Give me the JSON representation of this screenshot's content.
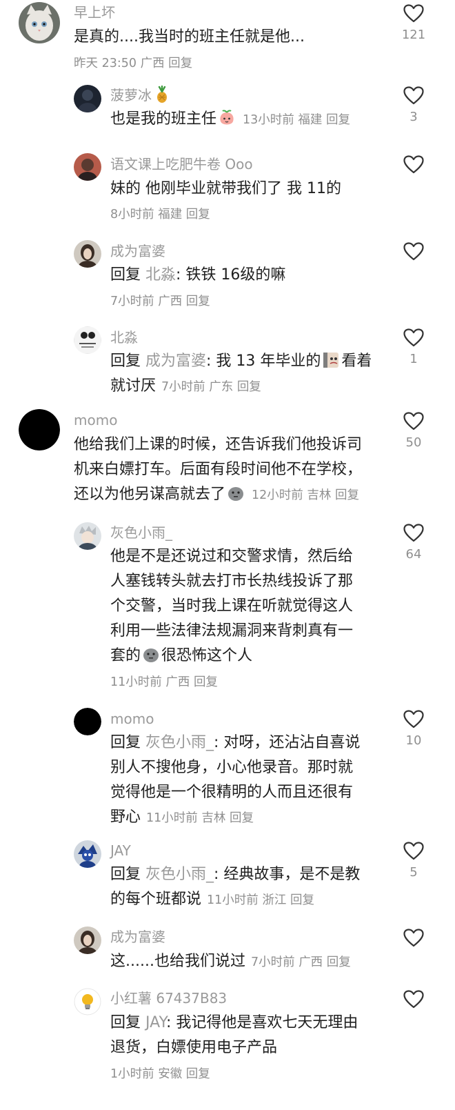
{
  "comments": [
    {
      "username": "早上坏",
      "lines": [
        "是真的....我当时的班主任就是他..."
      ],
      "time": "昨天 23:50",
      "location": "广西",
      "reply": "回复",
      "likes": "121"
    },
    {
      "username": "菠萝冰",
      "lines": [
        "也是我的班主任"
      ],
      "time": "13小时前",
      "location": "福建",
      "reply": "回复",
      "likes": "3"
    },
    {
      "username": "语文课上吃肥牛卷 Ooo",
      "lines": [
        "妹的 他刚毕业就带我们了 我 11的"
      ],
      "time": "8小时前",
      "location": "福建",
      "reply": "回复",
      "likes": ""
    },
    {
      "username": "成为富婆",
      "reply_prefix": "回复",
      "reply_to": "北淼",
      "lines": [
        ": 铁铁 16级的嘛"
      ],
      "time": "7小时前",
      "location": "广西",
      "reply": "回复",
      "likes": ""
    },
    {
      "username": "北淼",
      "reply_prefix": "回复",
      "reply_to": "成为富婆",
      "lines": [
        ": 我 13 年毕业的",
        "看着",
        "就讨厌"
      ],
      "time": "7小时前",
      "location": "广东",
      "reply": "回复",
      "likes": "1"
    },
    {
      "username": "momo",
      "lines": [
        "他给我们上课的时候，还告诉我们他投诉司",
        "机来白嫖打车。后面有段时间他不在学校，",
        "还以为他另谋高就去了"
      ],
      "time": "12小时前",
      "location": "吉林",
      "reply": "回复",
      "likes": "50"
    },
    {
      "username": "灰色小雨_",
      "lines": [
        "他是不是还说过和交警求情，然后给",
        "人塞钱转头就去打市长热线投诉了那",
        "个交警，当时我上课在听就觉得这人",
        "利用一些法律法规漏洞来背刺真有一",
        "套的",
        "很恐怖这个人"
      ],
      "time": "11小时前",
      "location": "广西",
      "reply": "回复",
      "likes": "64"
    },
    {
      "username": "momo",
      "reply_prefix": "回复",
      "reply_to": "灰色小雨_",
      "lines": [
        ": 对呀，还沾沾自喜说",
        "别人不搜他身，小心他录音。那时就",
        "觉得他是一个很精明的人而且还很有",
        "野心"
      ],
      "time": "11小时前",
      "location": "吉林",
      "reply": "回复",
      "likes": "10"
    },
    {
      "username": "JAY",
      "reply_prefix": "回复",
      "reply_to": "灰色小雨_",
      "lines": [
        ": 经典故事，是不是教",
        "的每个班都说"
      ],
      "time": "11小时前",
      "location": "浙江",
      "reply": "回复",
      "likes": "5"
    },
    {
      "username": "成为富婆",
      "lines": [
        "这......也给我们说过"
      ],
      "time": "7小时前",
      "location": "广西",
      "reply": "回复",
      "likes": ""
    },
    {
      "username": "小红薯 67437B83",
      "reply_prefix": "回复",
      "reply_to": "JAY",
      "lines": [
        ": 我记得他是喜欢七天无理由",
        "退货，白嫖使用电子产品"
      ],
      "time": "1小时前",
      "location": "安徽",
      "reply": "回复",
      "likes": ""
    }
  ],
  "icons": {
    "like": "heart-outline-icon",
    "pineapple": "pineapple-emoji",
    "peach": "peach-face-emoji",
    "meme": "meme-face-emoji",
    "stone": "stone-face-emoji"
  },
  "colors": {
    "username": "#9a9a9a",
    "text": "#1f1f1f",
    "meta": "#8f8f8f"
  }
}
